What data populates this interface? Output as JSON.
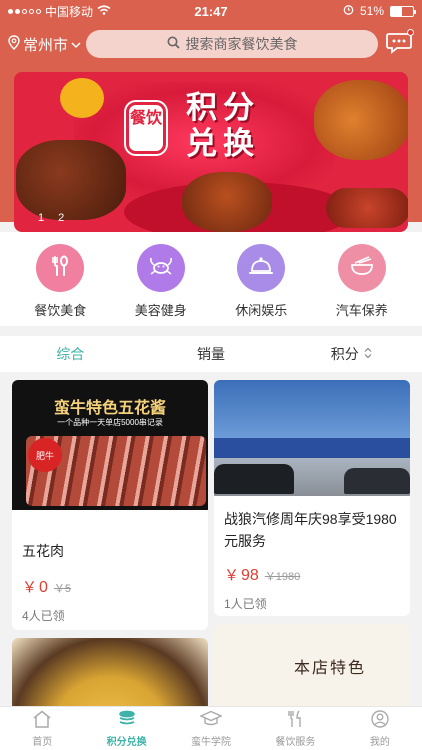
{
  "status": {
    "carrier": "中国移动",
    "time": "21:47",
    "battery": "51%"
  },
  "header": {
    "city": "常州市",
    "search_placeholder": "搜索商家餐饮美食"
  },
  "banner": {
    "title": "积分兑换",
    "badge": "餐饮",
    "pages": [
      "1",
      "2"
    ]
  },
  "categories": [
    {
      "label": "餐饮美食",
      "icon": "fork-spoon-icon",
      "color": "#f07fa0"
    },
    {
      "label": "美容健身",
      "icon": "crab-icon",
      "color": "#b07be8"
    },
    {
      "label": "休闲娱乐",
      "icon": "cloche-icon",
      "color": "#a98ce8"
    },
    {
      "label": "汽车保养",
      "icon": "bowl-icon",
      "color": "#ef8fa6"
    }
  ],
  "sort": {
    "items": [
      "综合",
      "销量",
      "积分"
    ],
    "active": "综合"
  },
  "products": [
    {
      "name": "五花肉",
      "price": "0",
      "currency": "￥",
      "old_price": "￥5",
      "sold": "4人已领",
      "img_text": "蛮牛特色五花酱",
      "img_sub": "一个品种一天单店5000串记录",
      "img_tag": "肥牛"
    },
    {
      "name": "战狼汽修周年庆98享受1980元服务",
      "price": "98",
      "currency": "￥",
      "old_price": "￥1980",
      "sold": "1人已领"
    },
    {
      "name": "",
      "img_text": ""
    },
    {
      "name": "",
      "img_text": "本店特色"
    }
  ],
  "tabbar": [
    {
      "label": "首页",
      "icon": "home-icon"
    },
    {
      "label": "积分兑换",
      "icon": "coins-icon"
    },
    {
      "label": "蛮牛学院",
      "icon": "graduation-cap-icon"
    },
    {
      "label": "餐饮服务",
      "icon": "dining-icon"
    },
    {
      "label": "我的",
      "icon": "user-icon"
    }
  ],
  "colors": {
    "brand": "#d9614d",
    "accent": "#3fb3a8",
    "price": "#e03c31"
  }
}
